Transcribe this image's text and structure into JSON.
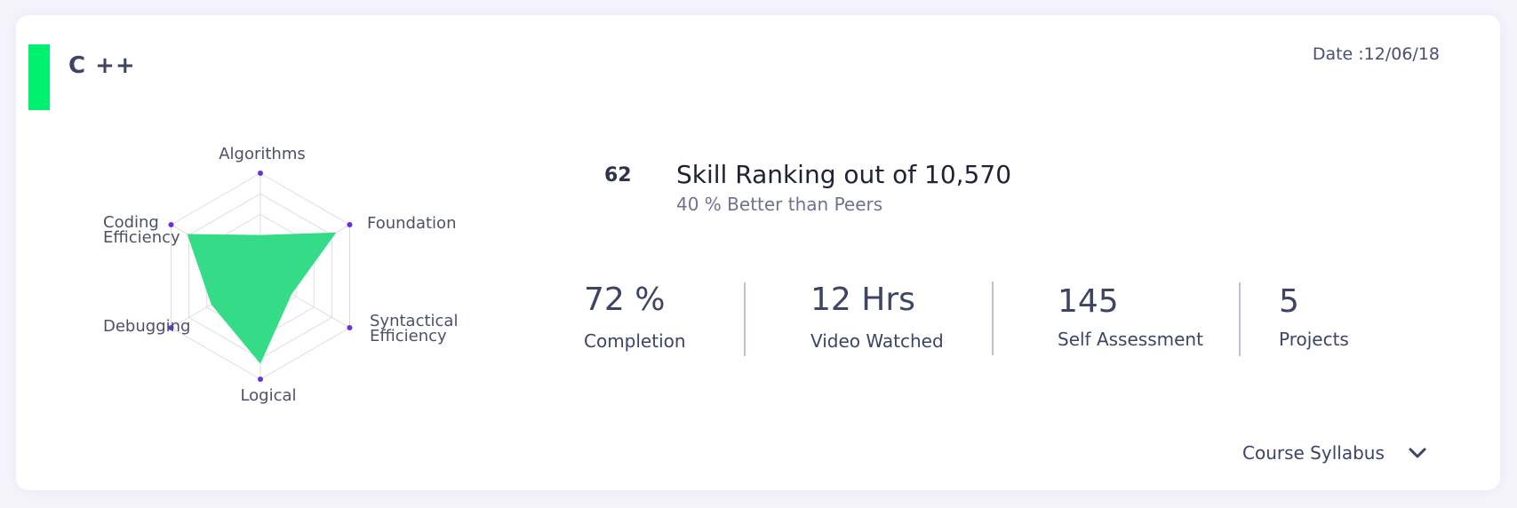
{
  "course": {
    "title": "C ++",
    "date": "Date :12/06/18",
    "accent_color": "#00f06f"
  },
  "radar_chart": {
    "type": "radar",
    "axes": [
      "Algorithms",
      "Foundation",
      "Syntactical Efficiency",
      "Logical",
      "Debugging",
      "Coding Efficiency"
    ],
    "axis_labels": {
      "algorithms": "Algorithms",
      "foundation": "Foundation",
      "syntactical_1": "Syntactical",
      "syntactical_2": "Efficiency",
      "logical": "Logical",
      "debugging": "Debugging",
      "coding_1": "Coding",
      "coding_2": "Efficiency"
    },
    "grid_levels": 5,
    "max": 1,
    "values": [
      0.4,
      0.85,
      0.35,
      0.85,
      0.55,
      0.82
    ],
    "fill_color": "#34dc88",
    "point_color": "#6a2ee8",
    "grid_color": "#dedede"
  },
  "ranking": {
    "rank": "62",
    "title": "Skill Ranking out of 10,570",
    "subtitle": "40 % Better than Peers"
  },
  "stats": [
    {
      "value": "72 %",
      "label": "Completion"
    },
    {
      "value": "12 Hrs",
      "label": "Video Watched"
    },
    {
      "value": "145",
      "label": "Self Assessment"
    },
    {
      "value": "5",
      "label": "Projects"
    }
  ],
  "footer": {
    "syllabus_label": "Course Syllabus",
    "chevron_icon": "chevron-down-icon"
  }
}
